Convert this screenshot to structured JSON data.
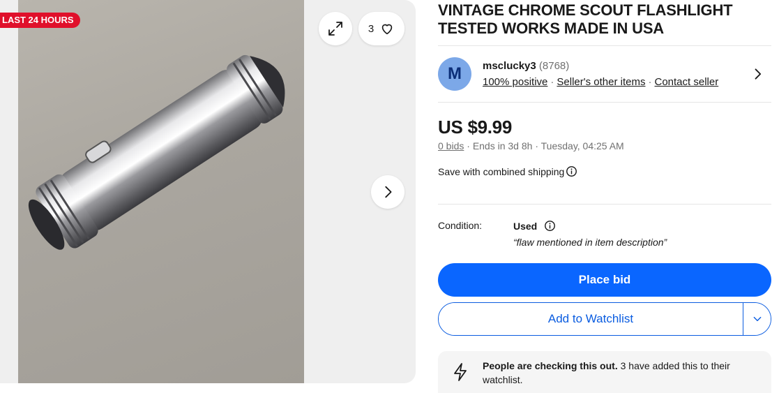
{
  "gallery": {
    "badge": "LAST 24 HOURS",
    "watch_count": "3",
    "image_alt_subject": "Chrome scout flashlight photo"
  },
  "listing": {
    "title": "VINTAGE CHROME SCOUT FLASHLIGHT TESTED WORKS MADE IN USA"
  },
  "seller": {
    "initial": "M",
    "name": "msclucky3",
    "feedback_count": "(8768)",
    "positive": "100% positive",
    "other_items": "Seller's other items",
    "contact": "Contact seller"
  },
  "pricing": {
    "price": "US $9.99",
    "bids": "0 bids",
    "ends": "Ends in 3d 8h",
    "end_time": "Tuesday, 04:25 AM",
    "shipping_note": "Save with combined shipping"
  },
  "condition": {
    "label": "Condition:",
    "value": "Used",
    "note": "“flaw mentioned in item description”"
  },
  "actions": {
    "place_bid": "Place bid",
    "watchlist": "Add to Watchlist"
  },
  "notice": {
    "bold": "People are checking this out.",
    "rest": " 3 have added this to their watchlist."
  },
  "colors": {
    "primary": "#0a66ff",
    "badge": "#e0102b",
    "avatar_bg": "#7ca8e8"
  }
}
